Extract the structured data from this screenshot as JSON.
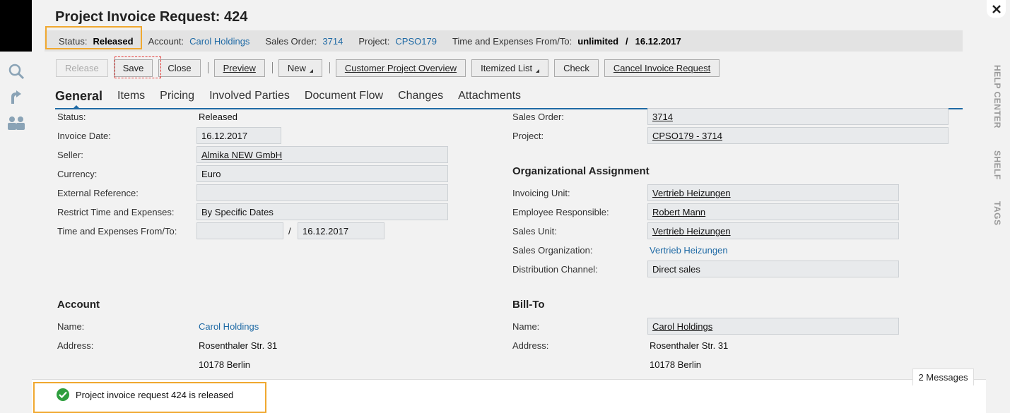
{
  "title": "Project Invoice Request: 424",
  "infobar": {
    "status_label": "Status:",
    "status_value": "Released",
    "account_label": "Account:",
    "account_value": "Carol Holdings",
    "sales_order_label": "Sales Order:",
    "sales_order_value": "3714",
    "project_label": "Project:",
    "project_value": "CPSO179",
    "te_label": "Time and Expenses From/To:",
    "te_from": "unlimited",
    "te_sep": "/",
    "te_to": "16.12.2017"
  },
  "toolbar": {
    "release": "Release",
    "save": "Save",
    "close": "Close",
    "preview": "Preview",
    "new": "New",
    "customer_project_overview": "Customer Project Overview",
    "itemized_list": "Itemized List",
    "check": "Check",
    "cancel_invoice_request": "Cancel Invoice Request"
  },
  "tabs": [
    "General",
    "Items",
    "Pricing",
    "Involved Parties",
    "Document Flow",
    "Changes",
    "Attachments"
  ],
  "left": {
    "status_label": "Status:",
    "status_value": "Released",
    "invoice_date_label": "Invoice Date:",
    "invoice_date_value": "16.12.2017",
    "seller_label": "Seller:",
    "seller_value": "Almika NEW GmbH",
    "currency_label": "Currency:",
    "currency_value": "Euro",
    "ext_ref_label": "External Reference:",
    "ext_ref_value": "",
    "restrict_label": "Restrict Time and Expenses:",
    "restrict_value": "By Specific Dates",
    "te_label": "Time and Expenses From/To:",
    "te_from": "",
    "te_sep": "/",
    "te_to": "16.12.2017"
  },
  "right": {
    "sales_order_label": "Sales Order:",
    "sales_order_value": "3714",
    "project_label": "Project:",
    "project_value": "CPSO179 - 3714",
    "org_heading": "Organizational Assignment",
    "invoicing_unit_label": "Invoicing Unit:",
    "invoicing_unit_value": "Vertrieb Heizungen",
    "employee_label": "Employee Responsible:",
    "employee_value": "Robert Mann",
    "sales_unit_label": "Sales Unit:",
    "sales_unit_value": "Vertrieb Heizungen",
    "sales_org_label": "Sales Organization:",
    "sales_org_value": "Vertrieb Heizungen",
    "dist_channel_label": "Distribution Channel:",
    "dist_channel_value": "Direct sales"
  },
  "account": {
    "heading": "Account",
    "name_label": "Name:",
    "name_value": "Carol Holdings",
    "address_label": "Address:",
    "address_line1": "Rosenthaler Str. 31",
    "address_line2": "10178 Berlin"
  },
  "bill_to": {
    "heading": "Bill-To",
    "name_label": "Name:",
    "name_value": "Carol Holdings",
    "address_label": "Address:",
    "address_line1": "Rosenthaler Str. 31",
    "address_line2": "10178 Berlin"
  },
  "side_tabs": [
    "HELP CENTER",
    "SHELF",
    "TAGS"
  ],
  "messages": {
    "count_label": "2 Messages",
    "text": "Project invoice request 424 is released"
  },
  "colors": {
    "link": "#1f6aa5",
    "highlight": "#f0a830",
    "success": "#2e9e3e"
  }
}
